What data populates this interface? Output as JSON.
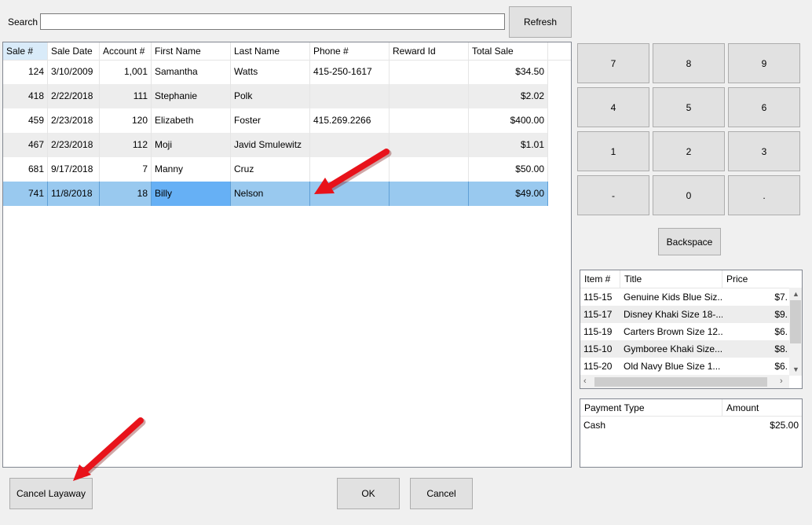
{
  "search": {
    "label": "Search",
    "value": ""
  },
  "refresh_label": "Refresh",
  "sales_grid": {
    "columns": [
      "Sale #",
      "Sale Date",
      "Account #",
      "First Name",
      "Last Name",
      "Phone #",
      "Reward Id",
      "Total Sale"
    ],
    "rows": [
      {
        "sale": "124",
        "date": "3/10/2009",
        "account": "1,001",
        "first": "Samantha",
        "last": "Watts",
        "phone": "415-250-1617",
        "reward": "",
        "total": "$34.50"
      },
      {
        "sale": "418",
        "date": "2/22/2018",
        "account": "111",
        "first": "Stephanie",
        "last": "Polk",
        "phone": "",
        "reward": "",
        "total": "$2.02"
      },
      {
        "sale": "459",
        "date": "2/23/2018",
        "account": "120",
        "first": "Elizabeth",
        "last": "Foster",
        "phone": "415.269.2266",
        "reward": "",
        "total": "$400.00"
      },
      {
        "sale": "467",
        "date": "2/23/2018",
        "account": "112",
        "first": "Moji",
        "last": "Javid Smulewitz",
        "phone": "",
        "reward": "",
        "total": "$1.01"
      },
      {
        "sale": "681",
        "date": "9/17/2018",
        "account": "7",
        "first": "Manny",
        "last": "Cruz",
        "phone": "",
        "reward": "",
        "total": "$50.00"
      },
      {
        "sale": "741",
        "date": "11/8/2018",
        "account": "18",
        "first": "Billy",
        "last": "Nelson",
        "phone": "",
        "reward": "",
        "total": "$49.00"
      }
    ],
    "selected_row": 5
  },
  "keypad": [
    "7",
    "8",
    "9",
    "4",
    "5",
    "6",
    "1",
    "2",
    "3",
    "-",
    "0",
    "."
  ],
  "backspace_label": "Backspace",
  "items": {
    "columns": [
      "Item #",
      "Title",
      "Price"
    ],
    "rows": [
      {
        "item": "115-15",
        "title": "Genuine Kids Blue Siz...",
        "price": "$7."
      },
      {
        "item": "115-17",
        "title": "Disney Khaki Size 18-...",
        "price": "$9."
      },
      {
        "item": "115-19",
        "title": "Carters Brown Size 12...",
        "price": "$6."
      },
      {
        "item": "115-10",
        "title": "Gymboree Khaki Size...",
        "price": "$8."
      },
      {
        "item": "115-20",
        "title": "Old Navy Blue Size 1...",
        "price": "$6."
      }
    ]
  },
  "payments": {
    "columns": [
      "Payment Type",
      "Amount"
    ],
    "rows": [
      {
        "type": "Cash",
        "amount": "$25.00"
      }
    ]
  },
  "buttons": {
    "cancel_layaway": "Cancel Layaway",
    "ok": "OK",
    "cancel": "Cancel"
  },
  "colors": {
    "selection": "#99c9ef",
    "focus_cell": "#66b0f5",
    "alt_row": "#ededed",
    "arrow": "#e8121a"
  }
}
